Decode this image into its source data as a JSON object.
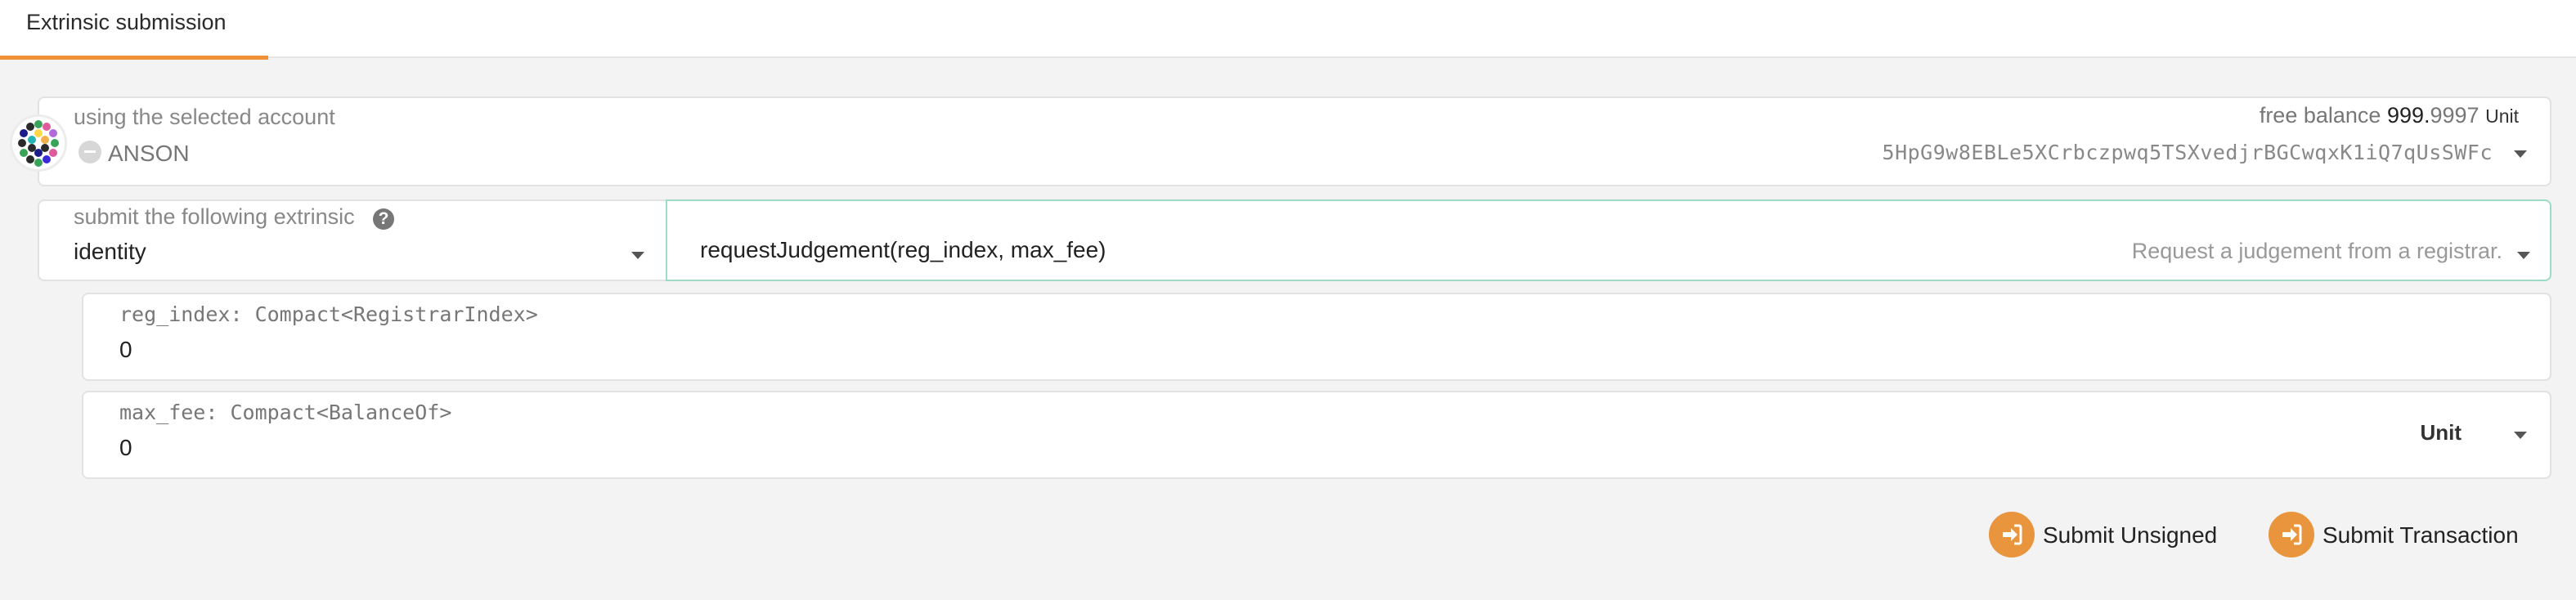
{
  "tabs": [
    {
      "label": "Extrinsic submission",
      "active": true
    }
  ],
  "account": {
    "label": "using the selected account",
    "name": "ANSON",
    "balance_label": "free balance",
    "balance_integer": "999.",
    "balance_fraction": "9997",
    "balance_unit": "Unit",
    "address": "5HpG9w8EBLe5XCrbczpwq5TSXvedjrBGCwqxK1iQ7qUsSWFc"
  },
  "extrinsic": {
    "label": "submit the following extrinsic",
    "help_icon": "question-circle-icon",
    "pallet": "identity",
    "method": "requestJudgement(reg_index, max_fee)",
    "method_description": "Request a judgement from a registrar."
  },
  "params": [
    {
      "label": "reg_index: Compact<RegistrarIndex>",
      "value": "0"
    },
    {
      "label": "max_fee: Compact<BalanceOf>",
      "value": "0",
      "unit": "Unit"
    }
  ],
  "actions": {
    "submit_unsigned": "Submit Unsigned",
    "submit_transaction": "Submit Transaction"
  },
  "colors": {
    "accent": "#f19135",
    "button_icon": "#e8953d",
    "focus_border": "#9edbc5"
  }
}
